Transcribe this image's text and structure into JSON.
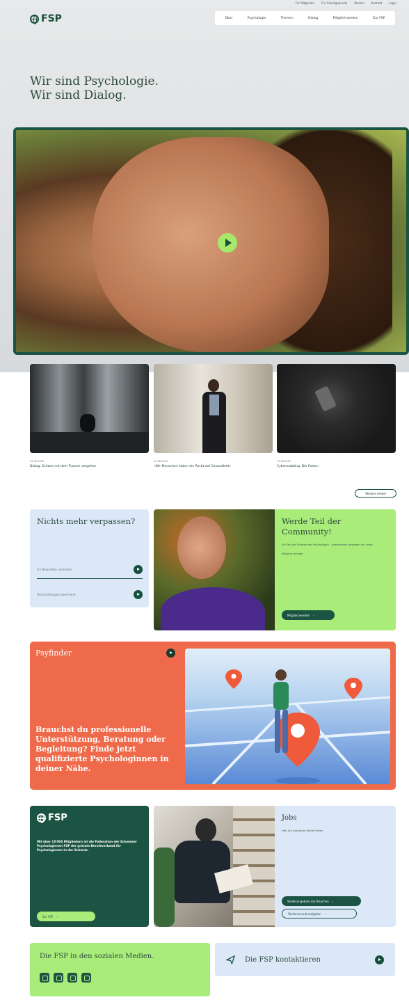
{
  "header": {
    "utility_links": [
      "Für Mitglieder",
      "Für Arbeitgebende",
      "Medien",
      "Kontakt",
      "Login"
    ],
    "logo_text": "FSP",
    "nav": [
      "Über",
      "Psychologie",
      "Themen",
      "Dialog",
      "Mitglied werden",
      "Zur FSP"
    ]
  },
  "hero": {
    "title_line1": "Wir sind Psychologie.",
    "title_line2": "Wir sind Dialog."
  },
  "cards": [
    {
      "meta": "22.06.2023",
      "title": "Dialog: Schwer mit dem Trauern umgehen"
    },
    {
      "meta": "22.06.2023",
      "title": "«Wir Menschen haben ein Recht auf Gesundheit»"
    },
    {
      "meta": "19.06.2023",
      "title": "Cybermobbing: Die Fakten"
    }
  ],
  "more_button": "Weitere Artikel",
  "newsletter": {
    "title": "Nichts mehr verpassen?",
    "row1": "Für Newsletter anmelden",
    "row2": "Veranstaltungen abonnieren"
  },
  "community": {
    "title": "Werde Teil der Community!",
    "text": "Sei Teil der Stimme der Psychologie – gemeinsam bewegen wir mehr.",
    "text2": "Mitglied werden",
    "button": "Mitglied werden"
  },
  "psyfinder": {
    "title": "Psyfinder",
    "text": "Brauchst du professionelle Unterstützung, Beratung oder Begleitung? Finde jetzt qualifizierte Psychologinnen in deiner Nähe."
  },
  "fsp_box": {
    "logo": "FSP",
    "text": "Mit über 10'000 Mitgliedern ist die Föderation der Schweizer Psychologinnen FSP der grösste Berufsverband für Psychologinnen in der Schweiz.",
    "button": "Zur FSP"
  },
  "jobs": {
    "title": "Jobs",
    "text": "Hier die passende Stelle finden.",
    "button1": "Stellenangebote durchsuchen",
    "button2": "Stelleninserat aufgeben"
  },
  "social": {
    "title": "Die FSP in den sozialen Medien.",
    "icons": [
      "linkedin-icon",
      "facebook-icon",
      "instagram-icon",
      "youtube-icon"
    ]
  },
  "contact": {
    "label": "Die FSP kontaktieren"
  }
}
